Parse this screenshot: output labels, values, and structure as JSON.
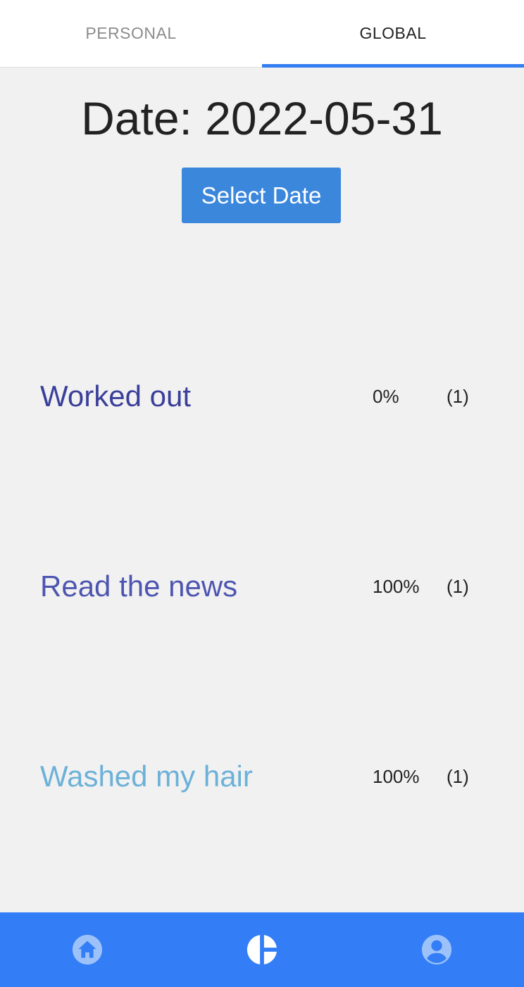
{
  "tabs": [
    {
      "label": "PERSONAL",
      "active": false
    },
    {
      "label": "GLOBAL",
      "active": true
    }
  ],
  "header": {
    "date_text": "Date: 2022-05-31",
    "select_button_label": "Select Date"
  },
  "stats": [
    {
      "label": "Worked out",
      "percent": "0%",
      "count": "(1)",
      "color": "#3a3f9a"
    },
    {
      "label": "Read the news",
      "percent": "100%",
      "count": "(1)",
      "color": "#4d55b0"
    },
    {
      "label": "Washed my hair",
      "percent": "100%",
      "count": "(1)",
      "color": "#6cb1d8"
    }
  ],
  "bottom_nav": [
    {
      "icon": "home-icon",
      "active": false
    },
    {
      "icon": "pie-chart-icon",
      "active": true
    },
    {
      "icon": "account-icon",
      "active": false
    }
  ],
  "colors": {
    "accent": "#337ef6",
    "button": "#3b87dc",
    "nav_icon_inactive": "#9cc2f9",
    "nav_icon_active": "#ffffff"
  }
}
